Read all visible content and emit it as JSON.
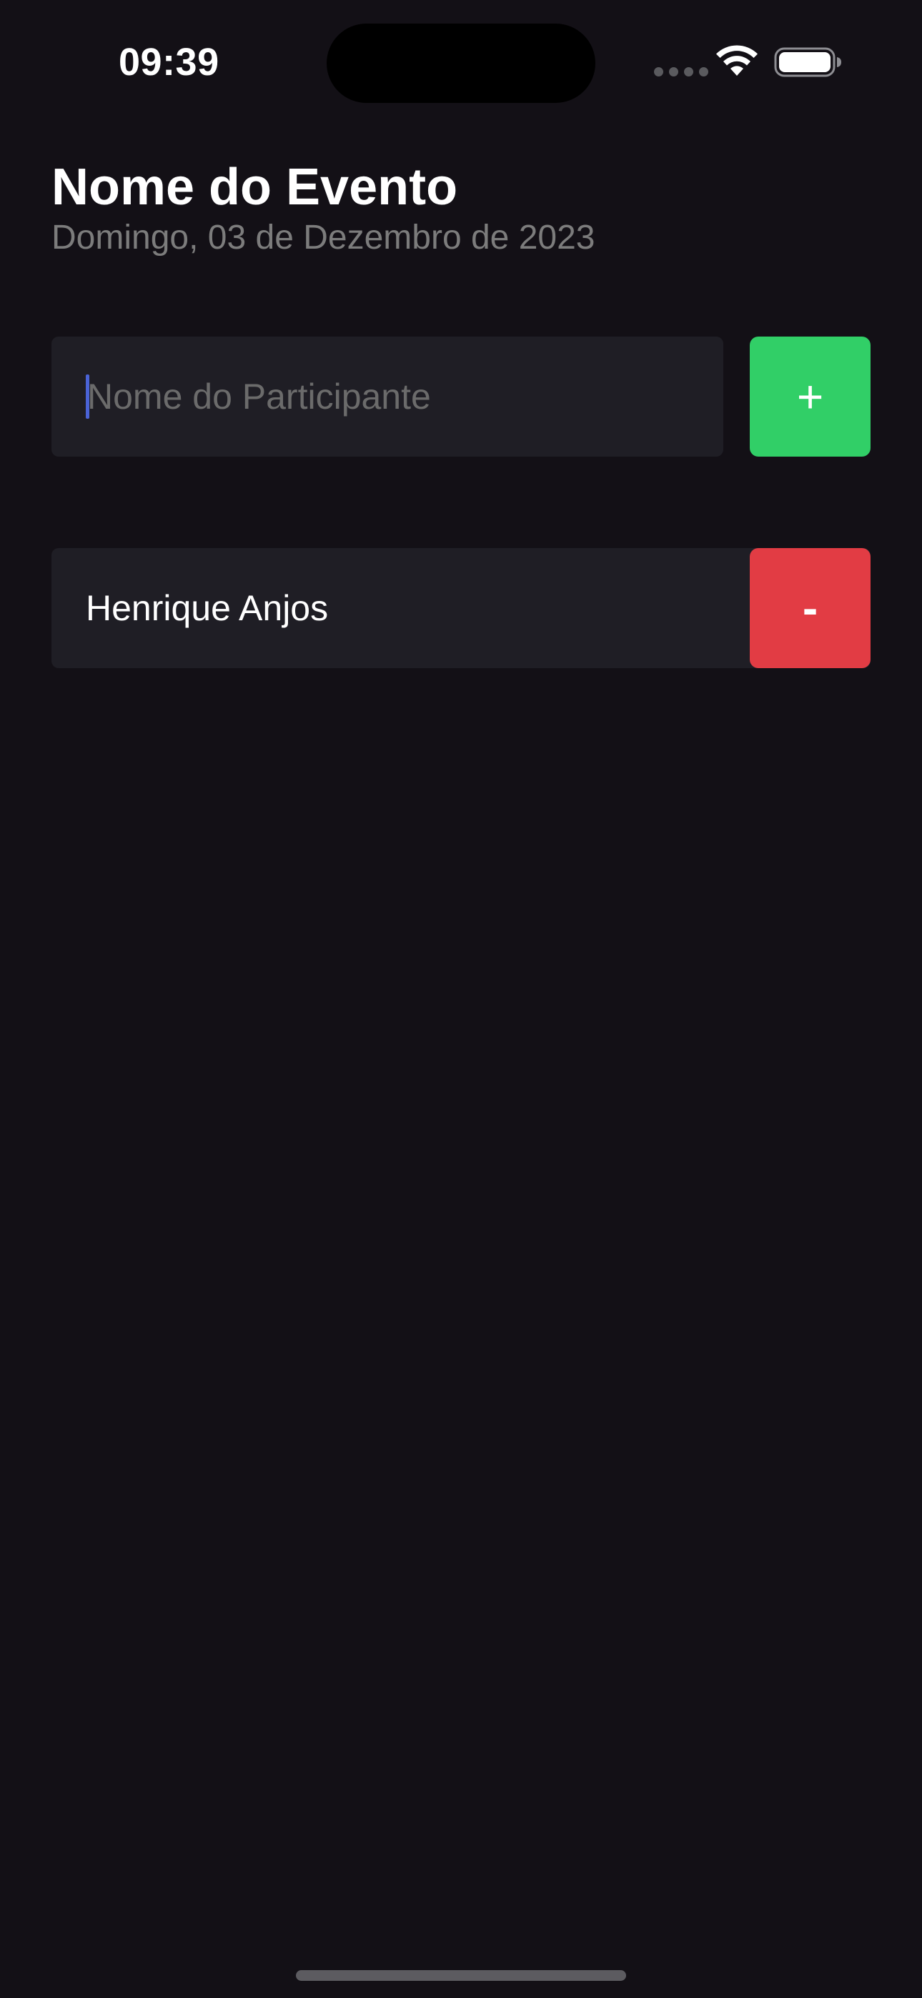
{
  "status_bar": {
    "time": "09:39",
    "icons": [
      "cellular-signal-icon",
      "wifi-icon",
      "battery-icon"
    ]
  },
  "header": {
    "title": "Nome do Evento",
    "date": "Domingo, 03 de Dezembro de 2023"
  },
  "form": {
    "input_placeholder": "Nome do Participante",
    "input_value": "",
    "add_label": "+"
  },
  "participants": [
    {
      "name": "Henrique Anjos",
      "remove_label": "-"
    }
  ],
  "colors": {
    "background": "#131016",
    "card": "#1f1e25",
    "add_button": "#31cf67",
    "remove_button": "#e23c44",
    "subtitle": "#7c7c7c",
    "caret": "#4a63d6"
  }
}
